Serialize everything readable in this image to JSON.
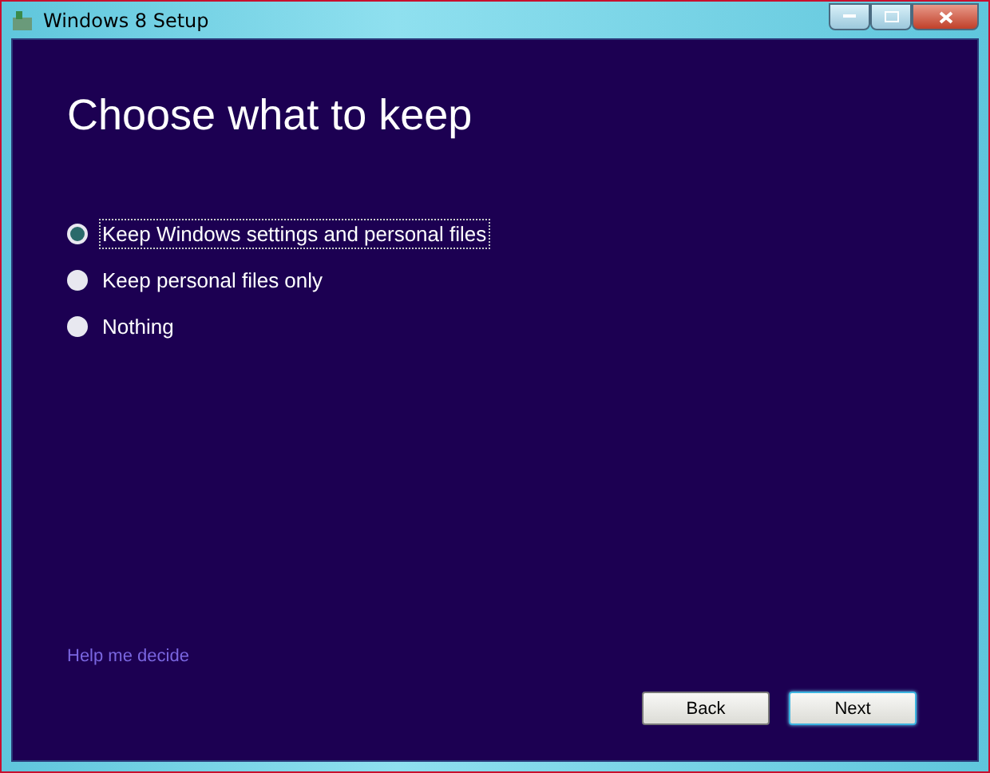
{
  "window": {
    "title": "Windows 8 Setup"
  },
  "heading": "Choose what to keep",
  "options": [
    {
      "label": "Keep Windows settings and personal files",
      "selected": true
    },
    {
      "label": "Keep personal files only",
      "selected": false
    },
    {
      "label": "Nothing",
      "selected": false
    }
  ],
  "help_link": "Help me decide",
  "buttons": [
    {
      "label": "Back",
      "default": false
    },
    {
      "label": "Next",
      "default": true
    }
  ]
}
